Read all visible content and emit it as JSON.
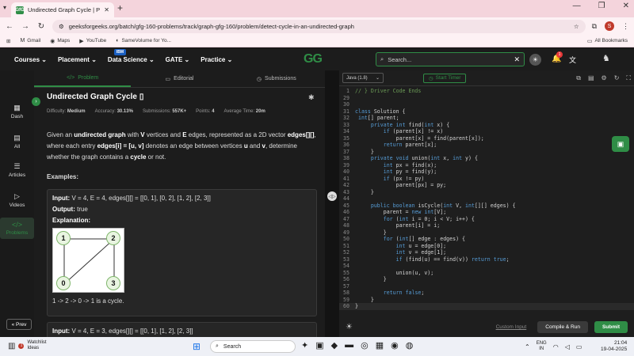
{
  "browser": {
    "tab_title": "Undirected Graph Cycle | Practic",
    "favicon_text": "GfG",
    "url": "geeksforgeeks.org/batch/gfg-160-problems/track/graph-gfg-160/problem/detect-cycle-in-an-undirected-graph",
    "profile_initial": "S",
    "bookmarks": [
      {
        "label": "Gmail",
        "icon": "M"
      },
      {
        "label": "Maps",
        "icon": "◉"
      },
      {
        "label": "YouTube",
        "icon": "▶"
      },
      {
        "label": "SameVolume for Yo...",
        "icon": "◐"
      }
    ],
    "all_bookmarks": "All Bookmarks"
  },
  "nav": {
    "items": [
      "Courses",
      "Placement",
      "Data Science",
      "GATE",
      "Practice"
    ],
    "ibm_badge": "IBM",
    "logo": "GG",
    "search_placeholder": "Search...",
    "notif_count": "1"
  },
  "sidebar": {
    "items": [
      {
        "label": "Dash",
        "icon": "▦"
      },
      {
        "label": "All",
        "icon": "▤"
      },
      {
        "label": "Articles",
        "icon": "☰"
      },
      {
        "label": "Videos",
        "icon": "▷"
      },
      {
        "label": "Problems",
        "icon": "</>"
      }
    ],
    "prev_label": "Prev"
  },
  "problem": {
    "tabs": [
      "Problem",
      "Editorial",
      "Submissions"
    ],
    "title": "Undirected Graph Cycle",
    "meta": {
      "difficulty_label": "Difficulty:",
      "difficulty": "Medium",
      "accuracy_label": "Accuracy:",
      "accuracy": "30.13%",
      "submissions_label": "Submissions:",
      "submissions": "557K+",
      "points_label": "Points:",
      "points": "4",
      "time_label": "Average Time:",
      "time": "20m"
    },
    "desc": {
      "p1": "Given an ",
      "b1": "undirected graph",
      "p2": " with ",
      "b2": "V",
      "p3": " vertices and ",
      "b3": "E",
      "p4": " edges, represented as a 2D vector ",
      "b4": "edges[][]",
      "p5": ", where each entry ",
      "b5": "edges[i] = [u, v]",
      "p6": " denotes an edge between vertices ",
      "b6": "u",
      "p7": " and ",
      "b7": "v",
      "p8": ", determine whether the graph contains a ",
      "b8": "cycle",
      "p9": " or not."
    },
    "examples_heading": "Examples:",
    "example1": {
      "input_label": "Input:",
      "input": " V = 4, E = 4, edges[][] = [[0, 1], [0, 2], [1, 2], [2, 3]]",
      "output_label": "Output:",
      "output": " true",
      "explanation_label": "Explanation:",
      "nodes": [
        "1",
        "2",
        "0",
        "3"
      ],
      "explanation": "1 -> 2 -> 0 -> 1 is a cycle."
    },
    "example2": {
      "input_label": "Input:",
      "input": " V = 4, E = 3, edges[][] = [[0, 1], [1, 2], [2, 3]]"
    }
  },
  "editor": {
    "language": "Java (1.8)",
    "timer_label": "Start Timer",
    "custom_input": "Custom Input",
    "compile_label": "Compile & Run",
    "submit_label": "Submit",
    "lines": [
      {
        "n": "1",
        "t": "// } Driver Code Ends",
        "c": "cm"
      },
      {
        "n": "29",
        "t": "",
        "c": ""
      },
      {
        "n": "30",
        "t": "",
        "c": ""
      },
      {
        "n": "31",
        "t": "class Solution {",
        "c": ""
      },
      {
        "n": "32",
        "t": " int[] parent;",
        "c": ""
      },
      {
        "n": "33",
        "t": "     private int find(int x) {",
        "c": ""
      },
      {
        "n": "34",
        "t": "         if (parent[x] != x)",
        "c": ""
      },
      {
        "n": "35",
        "t": "             parent[x] = find(parent[x]);",
        "c": ""
      },
      {
        "n": "36",
        "t": "         return parent[x];",
        "c": ""
      },
      {
        "n": "37",
        "t": "     }",
        "c": ""
      },
      {
        "n": "38",
        "t": "     private void union(int x, int y) {",
        "c": ""
      },
      {
        "n": "39",
        "t": "         int px = find(x);",
        "c": ""
      },
      {
        "n": "40",
        "t": "         int py = find(y);",
        "c": ""
      },
      {
        "n": "41",
        "t": "         if (px != py)",
        "c": ""
      },
      {
        "n": "42",
        "t": "             parent[px] = py;",
        "c": ""
      },
      {
        "n": "43",
        "t": "     }",
        "c": ""
      },
      {
        "n": "44",
        "t": "",
        "c": ""
      },
      {
        "n": "45",
        "t": "     public boolean isCycle(int V, int[][] edges) {",
        "c": ""
      },
      {
        "n": "46",
        "t": "         parent = new int[V];",
        "c": ""
      },
      {
        "n": "47",
        "t": "         for (int i = 0; i < V; i++) {",
        "c": ""
      },
      {
        "n": "48",
        "t": "             parent[i] = i;",
        "c": ""
      },
      {
        "n": "49",
        "t": "         }",
        "c": ""
      },
      {
        "n": "50",
        "t": "         for (int[] edge : edges) {",
        "c": ""
      },
      {
        "n": "51",
        "t": "             int u = edge[0];",
        "c": ""
      },
      {
        "n": "52",
        "t": "             int v = edge[1];",
        "c": ""
      },
      {
        "n": "53",
        "t": "             if (find(u) == find(v)) return true;",
        "c": ""
      },
      {
        "n": "54",
        "t": "",
        "c": ""
      },
      {
        "n": "55",
        "t": "             union(u, v);",
        "c": ""
      },
      {
        "n": "56",
        "t": "         }",
        "c": ""
      },
      {
        "n": "57",
        "t": "",
        "c": ""
      },
      {
        "n": "58",
        "t": "         return false;",
        "c": ""
      },
      {
        "n": "59",
        "t": "     }",
        "c": ""
      },
      {
        "n": "60",
        "t": "}",
        "c": "hl"
      }
    ]
  },
  "taskbar": {
    "weather_title": "Watchlist",
    "weather_sub": "Ideas",
    "weather_badge": "1",
    "search_placeholder": "Search",
    "lang_top": "ENG",
    "lang_bottom": "IN",
    "time": "21:04",
    "date": "19-04-2025"
  }
}
